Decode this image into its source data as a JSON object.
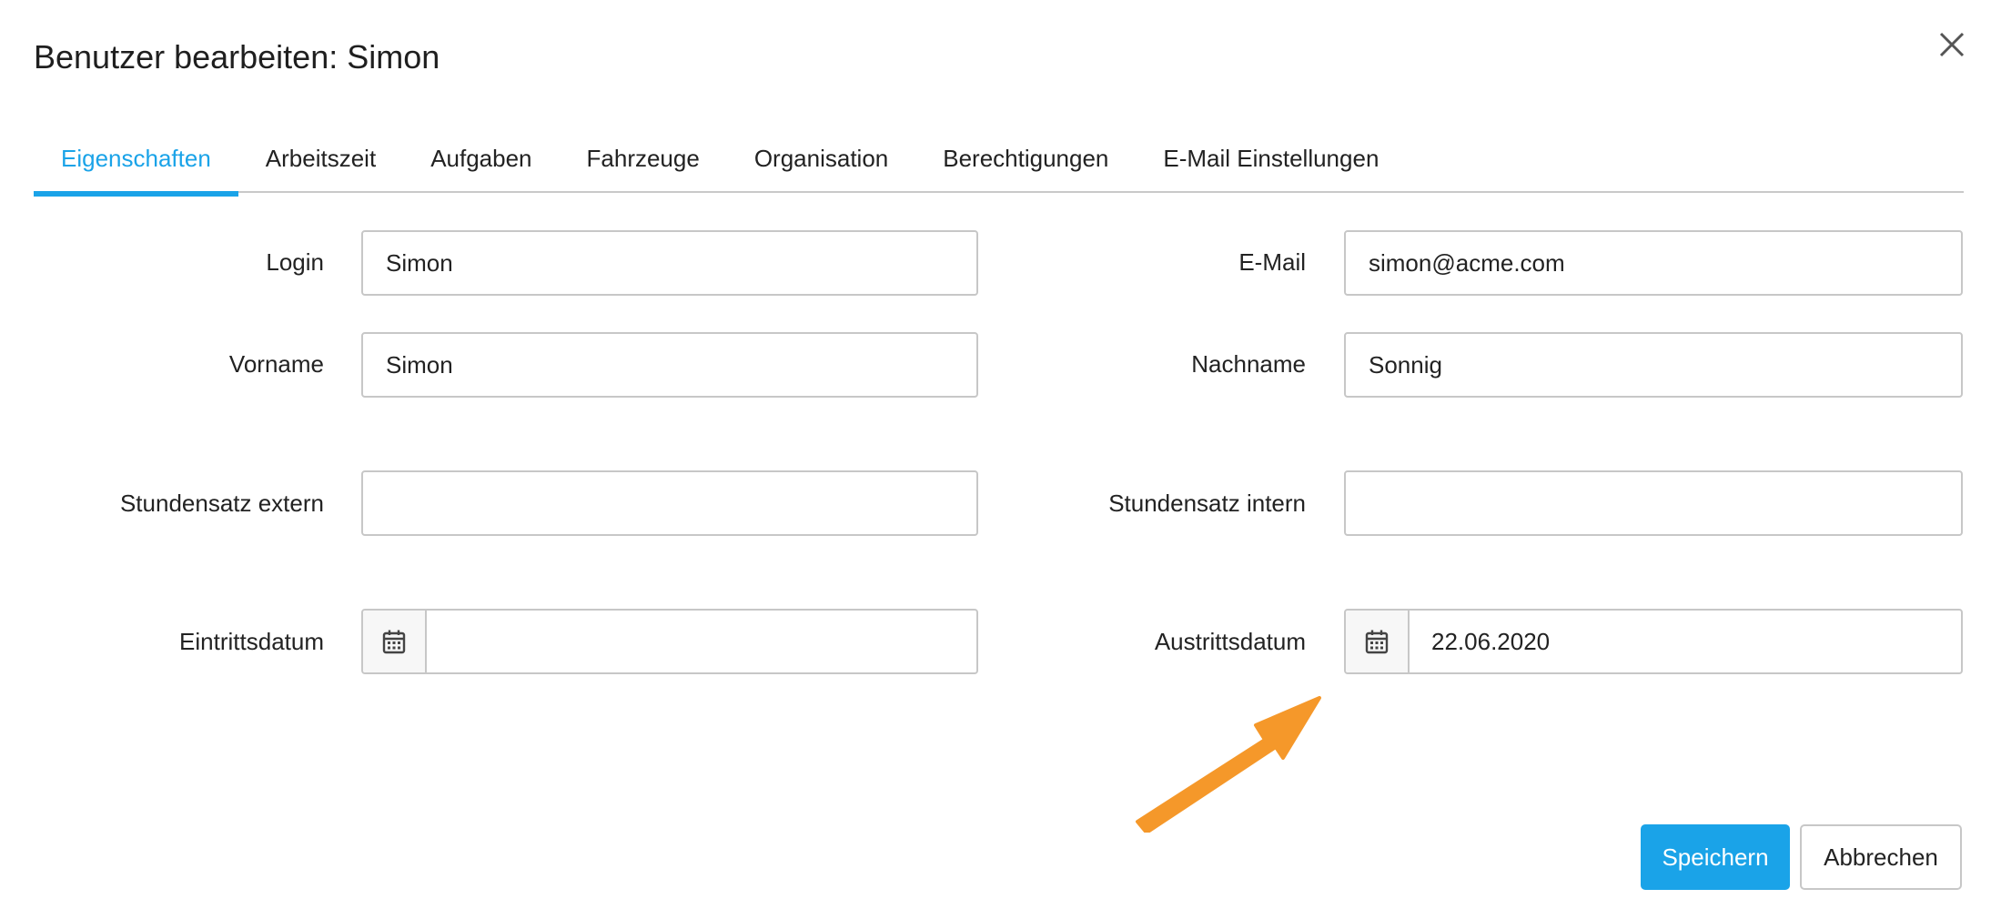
{
  "dialog": {
    "title": "Benutzer bearbeiten: Simon",
    "close_icon": "close-icon"
  },
  "tabs": [
    {
      "label": "Eigenschaften",
      "active": true
    },
    {
      "label": "Arbeitszeit"
    },
    {
      "label": "Aufgaben"
    },
    {
      "label": "Fahrzeuge"
    },
    {
      "label": "Organisation"
    },
    {
      "label": "Berechtigungen"
    },
    {
      "label": "E-Mail Einstellungen"
    }
  ],
  "form": {
    "login": {
      "label": "Login",
      "value": "Simon"
    },
    "email": {
      "label": "E-Mail",
      "value": "simon@acme.com"
    },
    "vorname": {
      "label": "Vorname",
      "value": "Simon"
    },
    "nachname": {
      "label": "Nachname",
      "value": "Sonnig"
    },
    "stundensatz_extern": {
      "label": "Stundensatz extern",
      "value": ""
    },
    "stundensatz_intern": {
      "label": "Stundensatz intern",
      "value": ""
    },
    "eintrittsdatum": {
      "label": "Eintrittsdatum",
      "value": "",
      "icon": "calendar-icon"
    },
    "austrittsdatum": {
      "label": "Austrittsdatum",
      "value": "22.06.2020",
      "icon": "calendar-icon"
    }
  },
  "actions": {
    "save_label": "Speichern",
    "cancel_label": "Abbrechen"
  },
  "colors": {
    "accent": "#1aa3e8",
    "annotation_arrow": "#f5982a"
  }
}
